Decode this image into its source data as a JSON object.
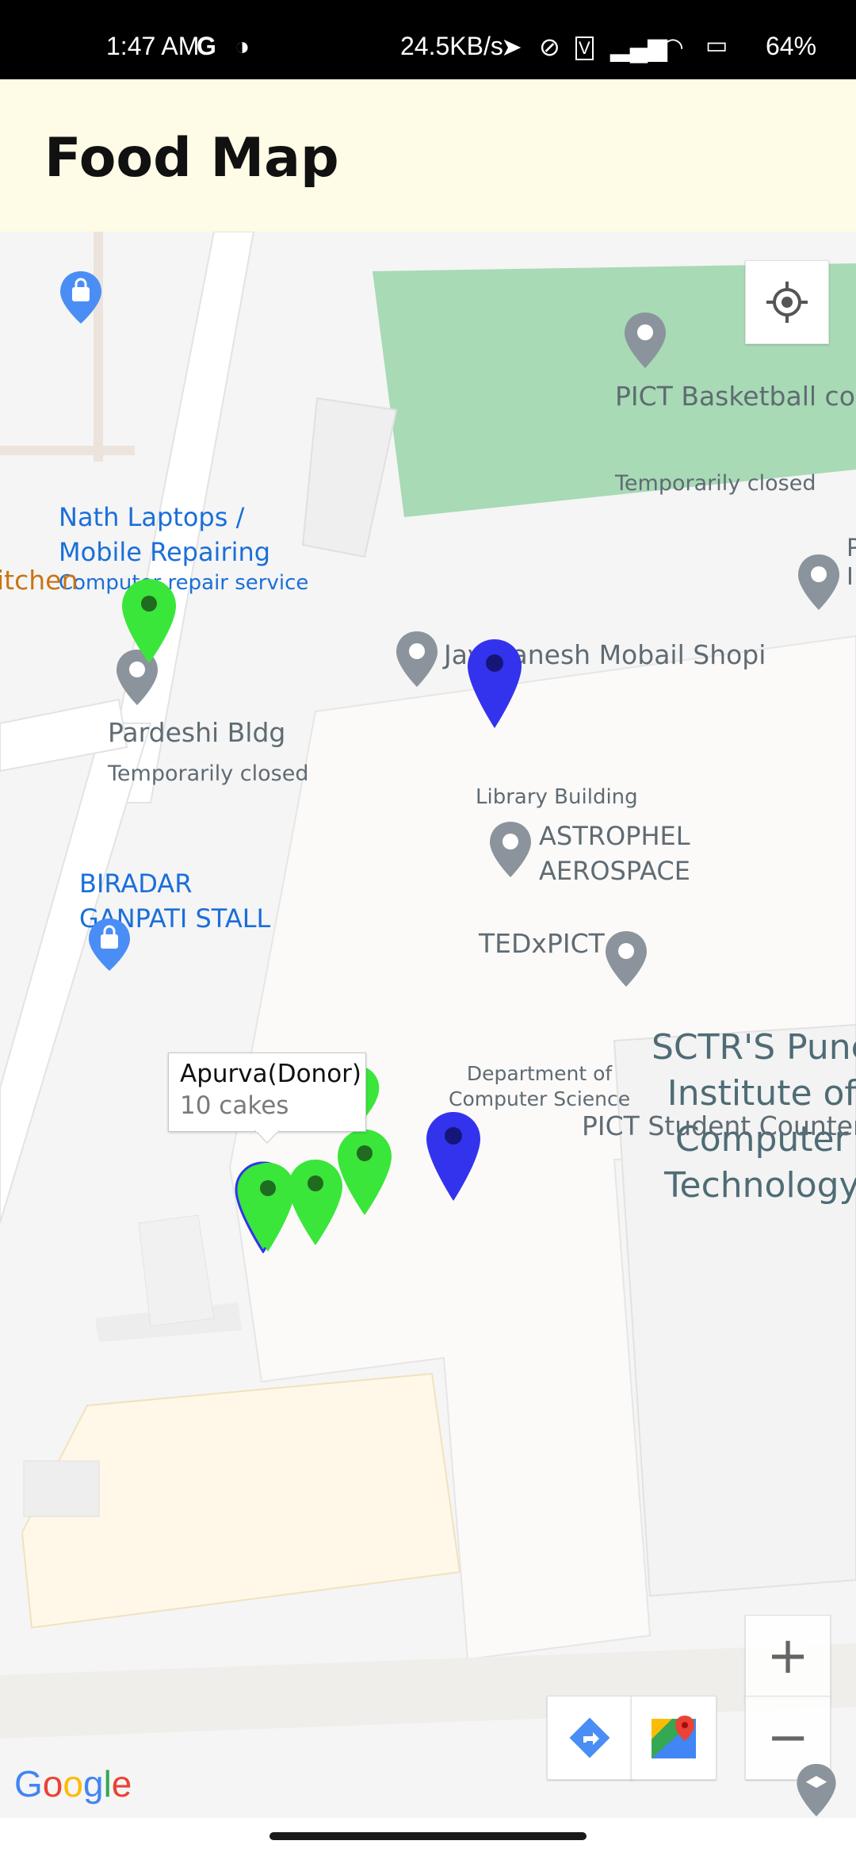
{
  "status_bar": {
    "time": "1:47 AM",
    "speed": "24.5KB/s",
    "battery": "64%"
  },
  "app_bar": {
    "title": "Food Map"
  },
  "map": {
    "places": {
      "nath_laptops_line1": "Nath Laptops /",
      "nath_laptops_line2": "Mobile Repairing",
      "nath_laptops_sub": "Computer repair service",
      "basketball": "PICT Basketball cour",
      "basketball_status": "Temporarily closed",
      "pardeshi": "Pardeshi Bldg",
      "pardeshi_status": "Temporarily closed",
      "kitchen": "itchen",
      "jay_ganesh": "Jay Ganesh Mobail Shopi",
      "library": "Library Building",
      "astrophel_line1": "ASTROPHEL",
      "astrophel_line2": "AEROSPACE",
      "biradar_line1": "BIRADAR",
      "biradar_line2": "GANPATI STALL",
      "tedx": "TEDxPICT",
      "sctr_line1": "SCTR'S Pune",
      "sctr_line2": "Institute of",
      "sctr_line3": "Computer",
      "sctr_line4": "Technology",
      "dept_line1": "Department of",
      "dept_line2": "Computer Science",
      "student_counter": "PICT Student Counter",
      "edge_p": "P",
      "edge_i": "I"
    },
    "info_window": {
      "title": "Apurva(Donor)",
      "subtitle": "10 cakes"
    },
    "marker_colors": {
      "donor": "#3ae63a",
      "receiver": "#3333ee"
    },
    "google_logo": "Google",
    "controls": {
      "zoom_in": "+",
      "zoom_out": "−"
    }
  }
}
